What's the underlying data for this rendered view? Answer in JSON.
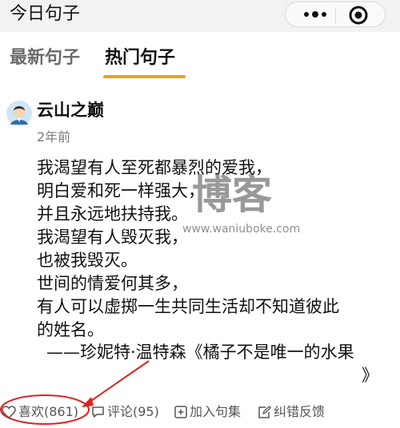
{
  "app": {
    "title": "今日句子"
  },
  "tabs": [
    {
      "label": "最新句子",
      "active": false
    },
    {
      "label": "热门句子",
      "active": true
    }
  ],
  "accent_color": "#f0a11b",
  "post": {
    "author": "云山之巅",
    "time": "2年前",
    "lines": [
      "我渴望有人至死都暴烈的爱我，",
      "明白爱和死一样强大，",
      "并且永远地扶持我。",
      "我渴望有人毁灭我，",
      "也被我毁灭。",
      "世间的情爱何其多，",
      "有人可以虚掷一生共同生活却不知道彼此",
      "的姓名。"
    ],
    "attribution": "——珍妮特·温特森《橘子不是唯一的水果",
    "attribution_end": "》"
  },
  "watermark": {
    "main": "博客",
    "url": "www.waniuboke.com"
  },
  "actions": {
    "like": "喜欢(861)",
    "comment": "评论(95)",
    "add": "加入句集",
    "report": "纠错反馈"
  },
  "icons": [
    "more-dots-icon",
    "target-icon",
    "avatar",
    "heart-icon",
    "comment-icon",
    "add-box-icon",
    "edit-icon"
  ]
}
